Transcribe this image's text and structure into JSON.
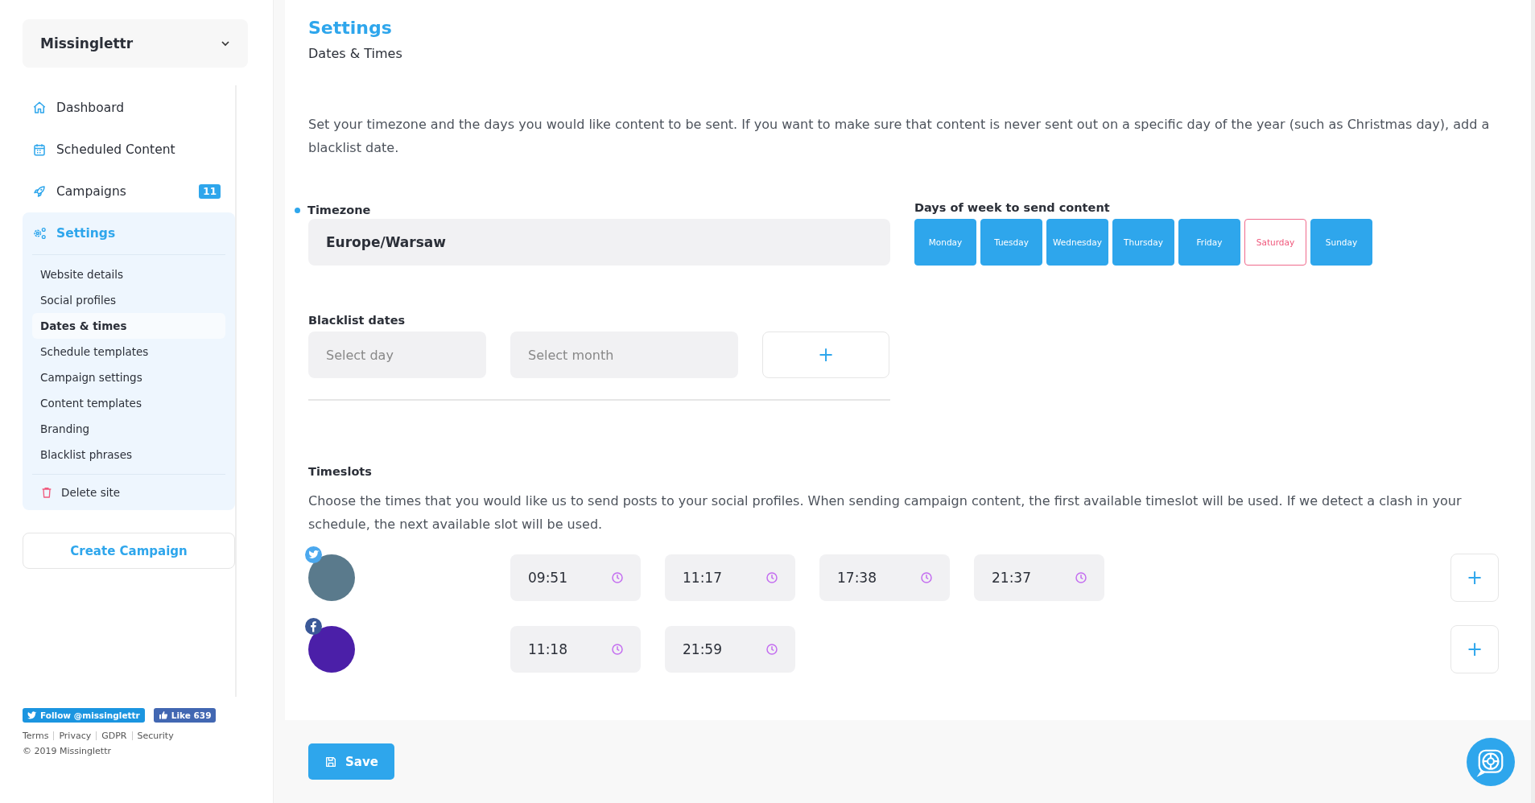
{
  "site_switcher": {
    "label": "Missinglettr"
  },
  "nav": [
    {
      "kind": "dashboard",
      "label": "Dashboard",
      "selected": false
    },
    {
      "kind": "calendar",
      "label": "Scheduled Content",
      "selected": false
    },
    {
      "kind": "rocket",
      "label": "Campaigns",
      "selected": false,
      "badge": "11"
    },
    {
      "kind": "gears",
      "label": "Settings",
      "selected": true
    }
  ],
  "settings_menu": [
    {
      "label": "Website details",
      "selected": false
    },
    {
      "label": "Social profiles",
      "selected": false
    },
    {
      "label": "Dates & times",
      "selected": true
    },
    {
      "label": "Schedule templates",
      "selected": false
    },
    {
      "label": "Campaign settings",
      "selected": false
    },
    {
      "label": "Content templates",
      "selected": false
    },
    {
      "label": "Branding",
      "selected": false
    },
    {
      "label": "Blacklist phrases",
      "selected": false
    }
  ],
  "delete_site": "Delete site",
  "create_campaign": "Create Campaign",
  "social_buttons": [
    {
      "kind": "twitter",
      "label": "Follow @missinglettr"
    },
    {
      "kind": "facebook",
      "label": "Like 639"
    }
  ],
  "footer_links": [
    "Terms",
    "Privacy",
    "GDPR",
    "Security"
  ],
  "copyright": "© 2019 Missinglettr",
  "page": {
    "title": "Settings",
    "subtitle": "Dates & Times"
  },
  "intro": "Set your timezone and the days you would like content to be sent. If you want to make sure that content is never sent out on a specific day of the year (such as Christmas day), add a blacklist date.",
  "timezone": {
    "label": "Timezone",
    "value": "Europe/Warsaw"
  },
  "days": {
    "label": "Days of week to send content",
    "items": [
      {
        "label": "Monday",
        "on": true
      },
      {
        "label": "Tuesday",
        "on": true
      },
      {
        "label": "Wednesday",
        "on": true
      },
      {
        "label": "Thursday",
        "on": true
      },
      {
        "label": "Friday",
        "on": true
      },
      {
        "label": "Saturday",
        "on": false
      },
      {
        "label": "Sunday",
        "on": true
      }
    ]
  },
  "blacklist": {
    "label": "Blacklist dates",
    "day": {
      "placeholder": "Select day"
    },
    "month": {
      "placeholder": "Select month"
    },
    "add": "+"
  },
  "timeslots": {
    "label": "Timeslots",
    "description": "Choose the times that you would like us to send posts to your social profiles. When sending campaign content, the first available timeslot will be used. If we detect a clash in your schedule, the next available slot will be used.",
    "profiles": [
      {
        "kind": "twitter",
        "times": [
          "09:51",
          "11:17",
          "17:38",
          "21:37"
        ],
        "add": "+"
      },
      {
        "kind": "facebook",
        "times": [
          "11:18",
          "21:59"
        ],
        "add": "+"
      }
    ]
  },
  "save": "Save"
}
